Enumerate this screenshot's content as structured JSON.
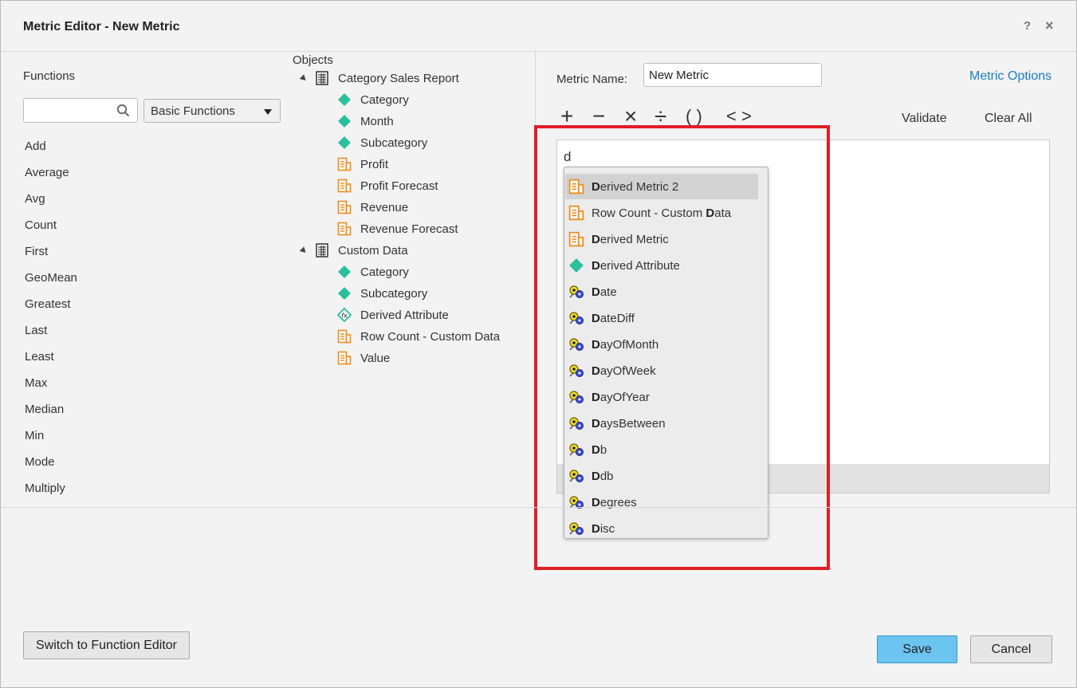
{
  "dialog": {
    "title": "Metric Editor - New Metric",
    "help": "?",
    "close": "×"
  },
  "functions": {
    "heading": "Functions",
    "search_value": "",
    "category": "Basic Functions",
    "items": [
      "Add",
      "Average",
      "Avg",
      "Count",
      "First",
      "GeoMean",
      "Greatest",
      "Last",
      "Least",
      "Max",
      "Median",
      "Min",
      "Mode",
      "Multiply"
    ]
  },
  "objects": {
    "heading": "Objects",
    "groups": [
      {
        "label": "Category Sales Report",
        "children": [
          {
            "label": "Category",
            "icon": "attribute-icon"
          },
          {
            "label": "Month",
            "icon": "attribute-icon"
          },
          {
            "label": "Subcategory",
            "icon": "attribute-icon"
          },
          {
            "label": "Profit",
            "icon": "metric-icon"
          },
          {
            "label": "Profit Forecast",
            "icon": "metric-icon"
          },
          {
            "label": "Revenue",
            "icon": "metric-icon"
          },
          {
            "label": "Revenue Forecast",
            "icon": "metric-icon"
          }
        ]
      },
      {
        "label": "Custom Data",
        "children": [
          {
            "label": "Category",
            "icon": "attribute-icon"
          },
          {
            "label": "Subcategory",
            "icon": "attribute-icon"
          },
          {
            "label": "Derived Attribute",
            "icon": "derived-attribute-icon"
          },
          {
            "label": "Row Count - Custom Data",
            "icon": "metric-icon"
          },
          {
            "label": "Value",
            "icon": "metric-icon"
          }
        ]
      }
    ]
  },
  "metric": {
    "name_label": "Metric Name:",
    "name_value": "New Metric",
    "options_link": "Metric Options",
    "operators": [
      "+",
      "−",
      "×",
      "÷",
      "( )",
      "< >"
    ],
    "validate": "Validate",
    "clear_all": "Clear All",
    "formula_text": "d"
  },
  "autocomplete": {
    "items": [
      {
        "pre": "",
        "bold": "D",
        "post": "erived Metric 2",
        "icon": "metric-icon",
        "selected": true
      },
      {
        "pre": "Row Count - Custom ",
        "bold": "D",
        "post": "ata",
        "icon": "metric-icon",
        "selected": false
      },
      {
        "pre": "",
        "bold": "D",
        "post": "erived Metric",
        "icon": "metric-icon",
        "selected": false
      },
      {
        "pre": "",
        "bold": "D",
        "post": "erived Attribute",
        "icon": "attribute-icon",
        "selected": false
      },
      {
        "pre": "",
        "bold": "D",
        "post": "ate",
        "icon": "function-icon",
        "selected": false
      },
      {
        "pre": "",
        "bold": "D",
        "post": "ateDiff",
        "icon": "function-icon",
        "selected": false
      },
      {
        "pre": "",
        "bold": "D",
        "post": "ayOfMonth",
        "icon": "function-icon",
        "selected": false
      },
      {
        "pre": "",
        "bold": "D",
        "post": "ayOfWeek",
        "icon": "function-icon",
        "selected": false
      },
      {
        "pre": "",
        "bold": "D",
        "post": "ayOfYear",
        "icon": "function-icon",
        "selected": false
      },
      {
        "pre": "",
        "bold": "D",
        "post": "aysBetween",
        "icon": "function-icon",
        "selected": false
      },
      {
        "pre": "",
        "bold": "D",
        "post": "b",
        "icon": "function-icon",
        "selected": false
      },
      {
        "pre": "",
        "bold": "D",
        "post": "db",
        "icon": "function-icon",
        "selected": false
      },
      {
        "pre": "",
        "bold": "D",
        "post": "egrees",
        "icon": "function-icon",
        "selected": false
      },
      {
        "pre": "",
        "bold": "D",
        "post": "isc",
        "icon": "function-icon",
        "selected": false
      }
    ]
  },
  "footer": {
    "switch_button": "Switch to Function Editor",
    "save": "Save",
    "cancel": "Cancel"
  },
  "colors": {
    "highlight": "#e01e26",
    "link": "#1a7dc4",
    "primary_button": "#6cc4f0",
    "attribute_icon": "#2bbf9e",
    "metric_icon": "#f08a1c"
  }
}
